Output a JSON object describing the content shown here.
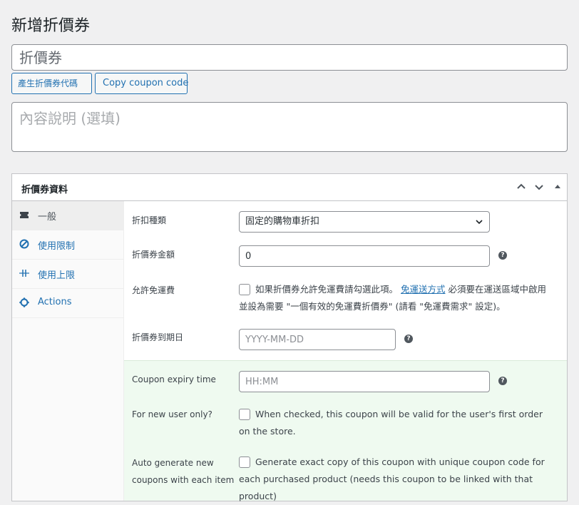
{
  "page": {
    "title": "新增折價券"
  },
  "title_field": {
    "placeholder": "折價券"
  },
  "buttons": {
    "generate": "產生折價券代碼",
    "copy": "Copy coupon code"
  },
  "description": {
    "placeholder": "內容說明 (選填)"
  },
  "panel": {
    "title": "折價券資料",
    "tabs": [
      {
        "label": "一般",
        "icon": "ticket-icon"
      },
      {
        "label": "使用限制",
        "icon": "ban-icon"
      },
      {
        "label": "使用上限",
        "icon": "limit-icon"
      },
      {
        "label": "Actions",
        "icon": "gear-icon"
      }
    ]
  },
  "general": {
    "discount_type": {
      "label": "折扣種類",
      "value": "固定的購物車折扣"
    },
    "amount": {
      "label": "折價券金額",
      "value": "0"
    },
    "free_shipping": {
      "label": "允許免運費",
      "text_before": "如果折價券允許免運費請勾選此項。",
      "link": "免運送方式",
      "text_after": "必須要在運送區域中啟用並設為需要 \"一個有效的免運費折價券\" (請看 \"免運費需求\" 設定)。"
    },
    "expiry_date": {
      "label": "折價券到期日",
      "placeholder": "YYYY-MM-DD"
    },
    "expiry_time": {
      "label": "Coupon expiry time",
      "placeholder": "HH:MM"
    },
    "new_user": {
      "label": "For new user only?",
      "text": "When checked, this coupon will be valid for the user's first order on the store."
    },
    "auto_generate": {
      "label": "Auto generate new coupons with each item",
      "text": "Generate exact copy of this coupon with unique coupon code for each purchased product (needs this coupon to be linked with that product)"
    }
  },
  "colors": {
    "accent": "#2271b1",
    "green_bg": "#effaf0"
  }
}
